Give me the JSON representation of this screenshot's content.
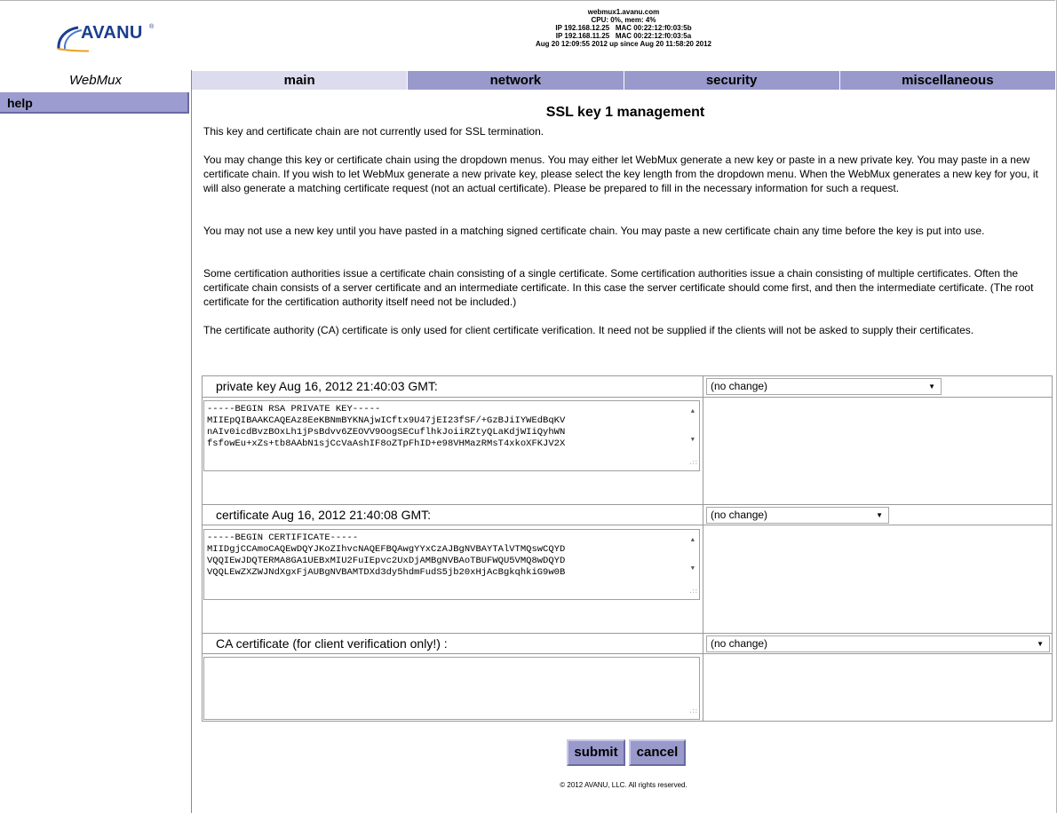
{
  "logo": {
    "text": "AVANU",
    "tm": "®"
  },
  "server": {
    "hostname": "webmux1.avanu.com",
    "cpu": "CPU: 0%, mem: 4%",
    "ip1": "IP 192.168.12.25   MAC 00:22:12:f0:03:5b",
    "ip2": "IP 192.168.11.25   MAC 00:22:12:f0:03:5a",
    "uptime": "Aug 20 12:09:55 2012 up since Aug 20 11:58:20 2012"
  },
  "app_title": "WebMux",
  "nav": {
    "help": "help"
  },
  "tabs": [
    {
      "label": "main",
      "active": true
    },
    {
      "label": "network",
      "active": false
    },
    {
      "label": "security",
      "active": false
    },
    {
      "label": "miscellaneous",
      "active": false
    }
  ],
  "page_title": "SSL key 1 management",
  "paragraphs": [
    "This key and certificate chain are not currently used for SSL termination.",
    "You may change this key or certificate chain using the dropdown menus. You may either let WebMux generate a new key or paste in a new private key. You may paste in a new certificate chain. If you wish to let WebMux generate a new private key, please select the key length from the dropdown menu. When the WebMux generates a new key for you, it will also generate a matching certificate request (not an actual certificate). Please be prepared to fill in the necessary information for such a request.",
    "You may not use a new key until you have pasted in a matching signed certificate chain. You may paste a new certificate chain any time before the key is put into use.",
    "Some certification authorities issue a certificate chain consisting of a single certificate. Some certification authorities issue a chain consisting of multiple certificates. Often the certificate chain consists of a server certificate and an intermediate certificate. In this case the server certificate should come first, and then the intermediate certificate. (The root certificate for the certification authority itself need not be included.)",
    "The certificate authority (CA) certificate is only used for client certificate verification. It need not be supplied if the clients will not be asked to supply their certificates."
  ],
  "form": {
    "private_key": {
      "label": "private key Aug 16, 2012 21:40:03 GMT:",
      "select_value": "(no change)",
      "text": "-----BEGIN RSA PRIVATE KEY-----\nMIIEpQIBAAKCAQEAz8EeKBNmBYKNAjwICftx9U47jEI23fSF/+GzBJiIYWEdBqKV\nnAIv0icdBvzBOxLh1jPsBdvv6ZEOVV9OogSECuflhkJoiiRZtyQLaKdjWIiQyhWN\nfsfowEu+xZs+tb8AAbN1sjCcVaAshIF8oZTpFhID+e98VHMazRMsT4xkoXFKJV2X"
    },
    "certificate": {
      "label": "certificate Aug 16, 2012 21:40:08 GMT:",
      "select_value": "(no change)",
      "text": "-----BEGIN CERTIFICATE-----\nMIIDgjCCAmoCAQEwDQYJKoZIhvcNAQEFBQAwgYYxCzAJBgNVBAYTAlVTMQswCQYD\nVQQIEwJDQTERMA8GA1UEBxMIU2FuIEpvc2UxDjAMBgNVBAoTBUFWQU5VMQ8wDQYD\nVQQLEwZXZWJNdXgxFjAUBgNVBAMTDXd3dy5hdmFudS5jb20xHjAcBgkqhkiG9w0B"
    },
    "ca_certificate": {
      "label": "CA certificate (for client verification only!) :",
      "select_value": "(no change)",
      "text": ""
    }
  },
  "buttons": {
    "submit": "submit",
    "cancel": "cancel"
  },
  "footer": "© 2012 AVANU, LLC. All rights reserved.",
  "icons": {
    "scroll_up": "▲",
    "scroll_down": "▼",
    "dropdown": "▼",
    "grip": ".::"
  }
}
